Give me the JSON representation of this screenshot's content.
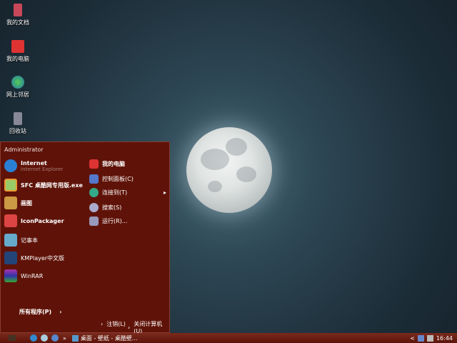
{
  "desktop": {
    "icons": [
      {
        "label": "我的文档",
        "icon": "documents-icon"
      },
      {
        "label": "我的电脑",
        "icon": "computer-icon"
      },
      {
        "label": "网上邻居",
        "icon": "network-icon"
      },
      {
        "label": "回收站",
        "icon": "recycle-bin-icon"
      }
    ]
  },
  "start_menu": {
    "user": "Administrator",
    "left_items": [
      {
        "label": "Internet",
        "sub": "Internet Explorer"
      },
      {
        "label": "SFC 桌酷网专用版.exe"
      },
      {
        "label": "画图"
      },
      {
        "label": "IconPackager"
      },
      {
        "label": "记事本"
      },
      {
        "label": "KMPlayer中文版"
      },
      {
        "label": "WinRAR"
      }
    ],
    "right_items": [
      {
        "label": "我的电脑"
      },
      {
        "label": "控制面板(C)"
      },
      {
        "label": "连接到(T)",
        "arrow": "▸"
      },
      {
        "label": "搜索(S)"
      },
      {
        "label": "运行(R)..."
      }
    ],
    "all_programs": "所有程序(P)",
    "logoff": "注销(L)",
    "shutdown": "关闭计算机(U)"
  },
  "taskbar": {
    "window_title": "桌面 - 壁纸 - 桌酷壁...",
    "clock": "16:44",
    "overflow": "»",
    "tray_arrow": "<"
  },
  "colors": {
    "menu_bg": "#5f1308",
    "taskbar": "#6b1e12"
  }
}
